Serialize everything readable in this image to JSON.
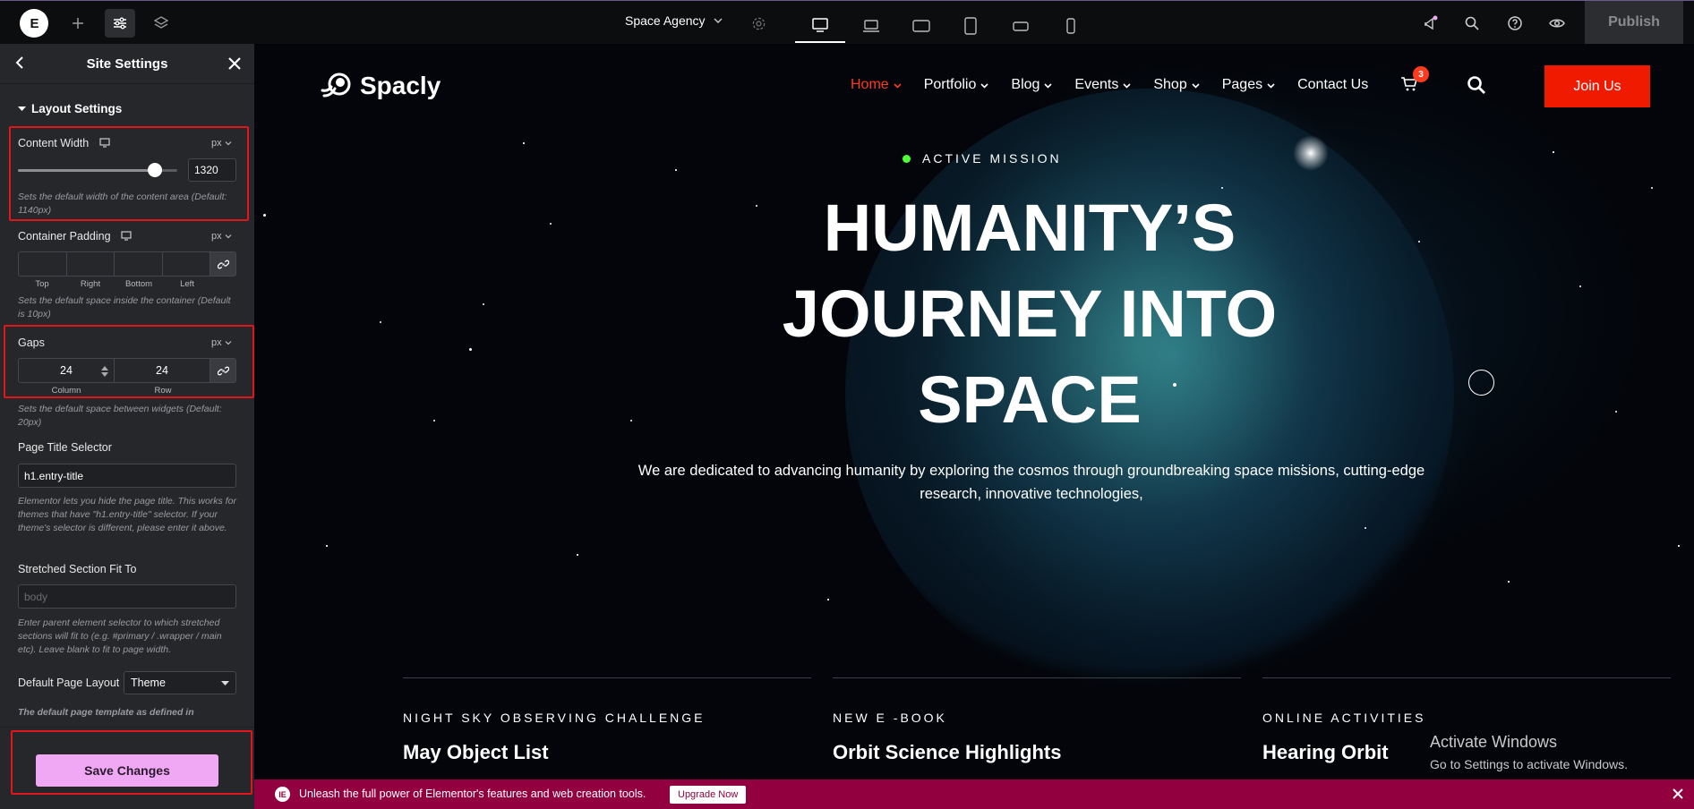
{
  "topbar": {
    "logo": "E",
    "site_name": "Space Agency",
    "publish_label": "Publish"
  },
  "sidebar": {
    "title": "Site Settings",
    "section": "Layout Settings",
    "content_width": {
      "label": "Content Width",
      "unit": "px",
      "value": "1320",
      "slider_fraction": 0.86,
      "hint": "Sets the default width of the content area (Default: 1140px)"
    },
    "container_padding": {
      "label": "Container Padding",
      "unit": "px",
      "sides": [
        "Top",
        "Right",
        "Bottom",
        "Left"
      ],
      "hint": "Sets the default space inside the container (Default is 10px)"
    },
    "gaps": {
      "label": "Gaps",
      "unit": "px",
      "column": "24",
      "row": "24",
      "column_label": "Column",
      "row_label": "Row",
      "hint": "Sets the default space between widgets (Default: 20px)"
    },
    "page_title_selector": {
      "label": "Page Title Selector",
      "value": "h1.entry-title",
      "hint": "Elementor lets you hide the page title. This works for themes that have \"h1.entry-title\" selector. If your theme's selector is different, please enter it above."
    },
    "stretched_section": {
      "label": "Stretched Section Fit To",
      "placeholder": "body",
      "hint": "Enter parent element selector to which stretched sections will fit to (e.g. #primary / .wrapper / main etc). Leave blank to fit to page width."
    },
    "default_page_layout": {
      "label": "Default Page Layout",
      "value": "Theme",
      "hint": "The default page template as defined in"
    },
    "save_label": "Save Changes"
  },
  "site": {
    "brand": "Spacly",
    "nav": [
      {
        "label": "Home",
        "active": true,
        "caret": true
      },
      {
        "label": "Portfolio",
        "active": false,
        "caret": true
      },
      {
        "label": "Blog",
        "active": false,
        "caret": true
      },
      {
        "label": "Events",
        "active": false,
        "caret": true
      },
      {
        "label": "Shop",
        "active": false,
        "caret": true
      },
      {
        "label": "Pages",
        "active": false,
        "caret": true
      },
      {
        "label": "Contact Us",
        "active": false,
        "caret": false
      }
    ],
    "cart_count": "3",
    "join_label": "Join Us",
    "kicker": "ACTIVE MISSION",
    "hero_lines": [
      "HUMANITY’S",
      "JOURNEY INTO",
      "SPACE"
    ],
    "lead_lines": [
      "We are dedicated to advancing humanity by exploring the cosmos through groundbreaking space missions, cutting-edge",
      "research, innovative technologies,"
    ],
    "cards": [
      {
        "category": "NIGHT SKY OBSERVING CHALLENGE",
        "title": "May Object List"
      },
      {
        "category": "NEW E -BOOK",
        "title": "Orbit Science Highlights"
      },
      {
        "category": "ONLINE ACTIVITIES",
        "title": "Hearing Orbit"
      }
    ]
  },
  "watermark": {
    "line1": "Activate Windows",
    "line2": "Go to Settings to activate Windows."
  },
  "promo": {
    "text": "Unleash the full power of Elementor's features and web creation tools.",
    "button": "Upgrade Now"
  },
  "colors": {
    "accent_red": "#ef1a00",
    "save_pink": "#f0a8f4",
    "promo_bg": "#93003f",
    "status_green": "#4eff35"
  }
}
